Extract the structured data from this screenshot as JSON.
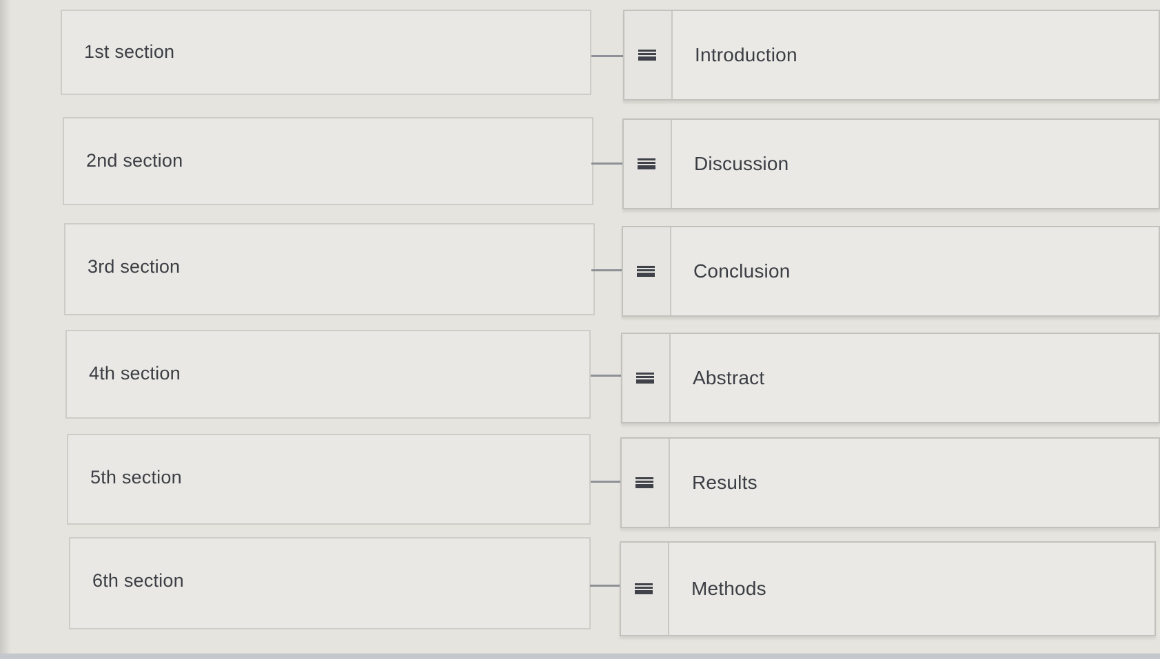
{
  "prompts": [
    {
      "label": "1st section"
    },
    {
      "label": "2nd section"
    },
    {
      "label": "3rd section"
    },
    {
      "label": "4th section"
    },
    {
      "label": "5th section"
    },
    {
      "label": "6th section"
    }
  ],
  "answers": [
    {
      "label": "Introduction"
    },
    {
      "label": "Discussion"
    },
    {
      "label": "Conclusion"
    },
    {
      "label": "Abstract"
    },
    {
      "label": "Results"
    },
    {
      "label": "Methods"
    }
  ],
  "icons": {
    "drag_handle": "drag-handle-icon"
  },
  "colors": {
    "background": "#e5e4df",
    "text": "#3b3e44",
    "connector": "#8d9096"
  }
}
